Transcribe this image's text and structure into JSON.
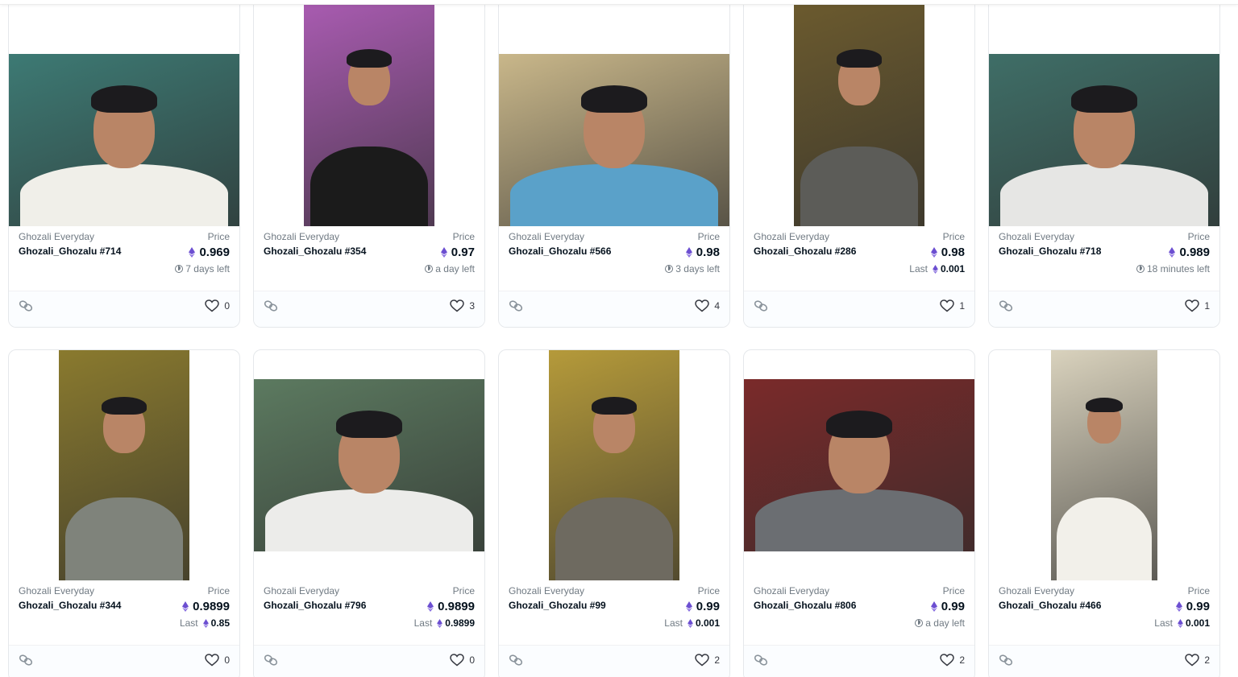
{
  "cards": [
    {
      "collection": "Ghozali Everyday",
      "token": "Ghozali_Ghozalu #714",
      "price_label": "Price",
      "price": "0.969",
      "sub_type": "time",
      "sub_text": "7 days left",
      "last_label": "",
      "last_value": "",
      "likes": "0",
      "photo": {
        "w": 286,
        "h": 214,
        "bg": "#3d7a74",
        "shirt": "#f0efe9"
      }
    },
    {
      "collection": "Ghozali Everyday",
      "token": "Ghozali_Ghozalu #354",
      "price_label": "Price",
      "price": "0.97",
      "sub_type": "time",
      "sub_text": "a day left",
      "last_label": "",
      "last_value": "",
      "likes": "3",
      "photo": {
        "w": 162,
        "h": 275,
        "bg": "#a85bb0",
        "shirt": "#1b1b1b"
      }
    },
    {
      "collection": "Ghozali Everyday",
      "token": "Ghozali_Ghozalu #566",
      "price_label": "Price",
      "price": "0.98",
      "sub_type": "time",
      "sub_text": "3 days left",
      "last_label": "",
      "last_value": "",
      "likes": "4",
      "photo": {
        "w": 286,
        "h": 214,
        "bg": "#c9b78a",
        "shirt": "#5aa1c9"
      }
    },
    {
      "collection": "Ghozali Everyday",
      "token": "Ghozali_Ghozalu #286",
      "price_label": "Price",
      "price": "0.98",
      "sub_type": "last",
      "sub_text": "",
      "last_label": "Last",
      "last_value": "0.001",
      "likes": "1",
      "photo": {
        "w": 162,
        "h": 275,
        "bg": "#6b5a2e",
        "shirt": "#5c5c58"
      }
    },
    {
      "collection": "Ghozali Everyday",
      "token": "Ghozali_Ghozalu #718",
      "price_label": "Price",
      "price": "0.989",
      "sub_type": "time",
      "sub_text": "18 minutes left",
      "last_label": "",
      "last_value": "",
      "likes": "1",
      "photo": {
        "w": 286,
        "h": 214,
        "bg": "#3f6e67",
        "shirt": "#e6e6e4"
      }
    },
    {
      "collection": "Ghozali Everyday",
      "token": "Ghozali_Ghozalu #344",
      "price_label": "Price",
      "price": "0.9899",
      "sub_type": "last",
      "sub_text": "",
      "last_label": "Last",
      "last_value": "0.85",
      "likes": "0",
      "photo": {
        "w": 162,
        "h": 286,
        "bg": "#8a7a2e",
        "shirt": "#7f837b"
      }
    },
    {
      "collection": "Ghozali Everyday",
      "token": "Ghozali_Ghozalu #796",
      "price_label": "Price",
      "price": "0.9899",
      "sub_type": "last",
      "sub_text": "",
      "last_label": "Last",
      "last_value": "0.9899",
      "likes": "0",
      "photo": {
        "w": 286,
        "h": 214,
        "bg": "#5c7a60",
        "shirt": "#ececea"
      }
    },
    {
      "collection": "Ghozali Everyday",
      "token": "Ghozali_Ghozalu #99",
      "price_label": "Price",
      "price": "0.99",
      "sub_type": "last",
      "sub_text": "",
      "last_label": "Last",
      "last_value": "0.001",
      "likes": "2",
      "photo": {
        "w": 162,
        "h": 286,
        "bg": "#b59a3a",
        "shirt": "#6e6a60"
      }
    },
    {
      "collection": "Ghozali Everyday",
      "token": "Ghozali_Ghozalu #806",
      "price_label": "Price",
      "price": "0.99",
      "sub_type": "time",
      "sub_text": "a day left",
      "last_label": "",
      "last_value": "",
      "likes": "2",
      "photo": {
        "w": 286,
        "h": 214,
        "bg": "#7a2a2a",
        "shirt": "#6b6e72"
      }
    },
    {
      "collection": "Ghozali Everyday",
      "token": "Ghozali_Ghozalu #466",
      "price_label": "Price",
      "price": "0.99",
      "sub_type": "last",
      "sub_text": "",
      "last_label": "Last",
      "last_value": "0.001",
      "likes": "2",
      "photo": {
        "w": 132,
        "h": 286,
        "bg": "#d9d2bd",
        "shirt": "#f2f0ea"
      }
    }
  ],
  "colors": {
    "eth": "#6c4fd1",
    "border": "#e5e8eb",
    "muted": "#707a83",
    "text": "#04111d"
  },
  "icons": {
    "footer_left": "link-icon",
    "footer_right": "heart-icon",
    "timer": "clock-icon",
    "currency": "ethereum-icon"
  }
}
